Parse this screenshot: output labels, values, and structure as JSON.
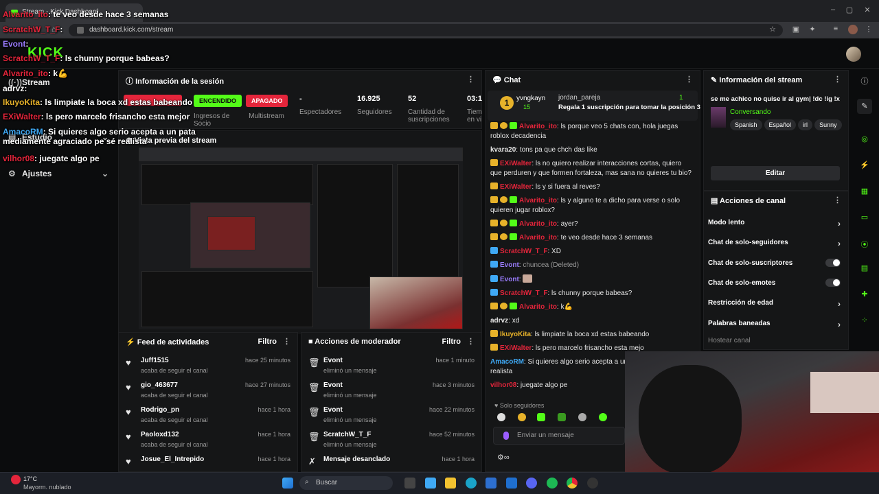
{
  "browser": {
    "tab_title": "Stream - Kick Dashboard",
    "url": "dashboard.kick.com/stream"
  },
  "colors": {
    "brand": "#53fc18",
    "background": "#0b0c0d",
    "panel": "#151617",
    "apagado": "#e4253b",
    "user_red": "#e4253b",
    "user_blue": "#3fa9f5"
  },
  "sidebar": {
    "items": [
      {
        "label": "Stream",
        "icon": "broadcast-icon"
      },
      {
        "label": "Estudio",
        "icon": "studio-icon"
      },
      {
        "label": "Ajustes",
        "icon": "gear-icon"
      }
    ]
  },
  "session": {
    "title": "Información de la sesión",
    "stats": [
      {
        "label": "Multistream",
        "value": "APAGADO"
      },
      {
        "label": "Espectadores",
        "value": "-"
      },
      {
        "label": "Seguidores",
        "value": "16.925"
      },
      {
        "label": "Cantidad de suscripciones",
        "value": "52"
      }
    ],
    "encendido": "ENCENDIDO",
    "ingresos_label": "Ingresos de Socio",
    "tiempo_value": "03:1",
    "tiempo_label": "Tiem en vi"
  },
  "preview": {
    "title": "Vista previa del stream"
  },
  "feed": {
    "title": "Feed de actividades",
    "filter": "Filtro",
    "items": [
      {
        "name": "Juff1515",
        "sub": "acaba de seguir el canal",
        "time": "hace 25 minutos"
      },
      {
        "name": "gio_463677",
        "sub": "acaba de seguir el canal",
        "time": "hace 27 minutos"
      },
      {
        "name": "Rodrigo_pn",
        "sub": "acaba de seguir el canal",
        "time": "hace 1 hora"
      },
      {
        "name": "Paoloxd132",
        "sub": "acaba de seguir el canal",
        "time": "hace 1 hora"
      },
      {
        "name": "Josue_El_Intrepido",
        "sub": "",
        "time": "hace 1 hora"
      }
    ]
  },
  "mod": {
    "title": "Acciones de moderador",
    "filter": "Filtro",
    "items": [
      {
        "name": "Evont",
        "sub": "eliminó un mensaje",
        "time": "hace 1 minuto"
      },
      {
        "name": "Evont",
        "sub": "eliminó un mensaje",
        "time": "hace 3 minutos"
      },
      {
        "name": "Evont",
        "sub": "eliminó un mensaje",
        "time": "hace 22 minutos"
      },
      {
        "name": "ScratchW_T_F",
        "sub": "eliminó un mensaje",
        "time": "hace 52 minutos"
      },
      {
        "name": "Mensaje desanclado",
        "sub": "",
        "time": "hace 1 hora"
      }
    ]
  },
  "chat": {
    "title": "Chat",
    "pinned": {
      "user": "yvngkayn",
      "count": "15",
      "target": "jordan_pareja",
      "target_count": "1",
      "text": "Regala 1 suscripción para tomar la posición 3"
    },
    "messages": [
      {
        "user": "Alvarito_ito",
        "color": "#e4253b",
        "text": "ls porque veo 5 chats con, hola juegas roblox decadencia"
      },
      {
        "user": "kvara20",
        "color": "#e6e6e6",
        "text": "tons pa que chch das like"
      },
      {
        "user": "EXiWalter",
        "color": "#e4253b",
        "text": "ls no quiero realizar interacciones cortas, quiero que perduren y que formen fortaleza, mas sana no quieres tu bio?"
      },
      {
        "user": "EXiWalter",
        "color": "#e4253b",
        "text": "ls y si fuera al reves?"
      },
      {
        "user": "Alvarito_ito",
        "color": "#e4253b",
        "text": "ls y alguno te a dicho para verse o solo quieren jugar roblox?"
      },
      {
        "user": "Alvarito_ito",
        "color": "#e4253b",
        "text": "ayer?"
      },
      {
        "user": "Alvarito_ito",
        "color": "#e4253b",
        "text": "te veo desde hace 3 semanas"
      },
      {
        "user": "ScratchW_T_F",
        "color": "#e4253b",
        "text": "XD"
      },
      {
        "user": "Evont",
        "color": "#9b7dff",
        "text": "chuncea (Deleted)"
      },
      {
        "user": "Evont",
        "color": "#9b7dff",
        "text": ""
      },
      {
        "user": "ScratchW_T_F",
        "color": "#e4253b",
        "text": "ls chunny porque babeas?"
      },
      {
        "user": "Alvarito_ito",
        "color": "#e4253b",
        "text": "k💪"
      },
      {
        "user": "adrvz",
        "color": "#e6e6e6",
        "text": "xd"
      },
      {
        "user": "IkuyoKita",
        "color": "#e7b22a",
        "text": "ls limpiate la boca xd estas babeando"
      },
      {
        "user": "EXiWalter",
        "color": "#e4253b",
        "text": "ls pero marcelo frisancho esta mejo"
      },
      {
        "user": "AmacoRM",
        "color": "#3fa9f5",
        "text": "Si quieres algo serio acepta a un p agraciado pe sé realista"
      },
      {
        "user": "vilhor08",
        "color": "#e4253b",
        "text": "juegate algo pe"
      }
    ],
    "mode_label": "Solo seguidores",
    "input_placeholder": "Enviar un mensaje"
  },
  "stream_info": {
    "title": "Información del stream",
    "stream_title": "se me achico no quise ir al gym| !dc !ig !x",
    "category": "Conversando",
    "tags": [
      "Spanish",
      "Español",
      "irl",
      "Sunny"
    ],
    "edit_label": "Editar"
  },
  "channel_actions": {
    "title": "Acciones de canal",
    "items": [
      {
        "label": "Modo lento",
        "type": "chevron"
      },
      {
        "label": "Chat de solo-seguidores",
        "type": "chevron"
      },
      {
        "label": "Chat de solo-suscriptores",
        "type": "toggle"
      },
      {
        "label": "Chat de solo-emotes",
        "type": "toggle"
      },
      {
        "label": "Restricción de edad",
        "type": "chevron"
      },
      {
        "label": "Palabras baneadas",
        "type": "chevron"
      }
    ],
    "host_label": "Hostear canal"
  },
  "overlay_chat": [
    {
      "user": "Alvarito_ito",
      "text": "te veo desde hace 3 semanas"
    },
    {
      "user": "ScratchW_T_F",
      "text": ""
    },
    {
      "user": "Evont",
      "text": ""
    },
    {
      "user": "ScratchW_T_F",
      "text": "ls chunny porque babeas?"
    },
    {
      "user": "Alvarito_ito",
      "text": "k💪"
    },
    {
      "user": "adrvz",
      "text": ""
    },
    {
      "user": "IkuyoKita",
      "text": "ls limpiate la boca xd estas babeando"
    },
    {
      "user": "EXiWalter",
      "text": "ls pero marcelo frisancho esta mejor"
    },
    {
      "user": "AmacoRM",
      "text": "Si quieres algo serio acepta a un pata mediamente agraciado pe sé realista"
    },
    {
      "user": "vilhor08",
      "text": "juegate algo pe"
    }
  ],
  "taskbar": {
    "weather_temp": "17°C",
    "weather_desc": "Mayorm. nublado",
    "search_placeholder": "Buscar"
  }
}
